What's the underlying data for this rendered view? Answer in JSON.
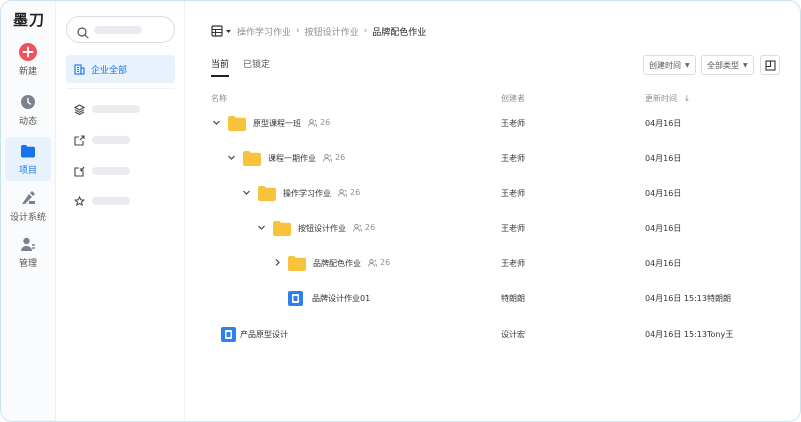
{
  "app": {
    "logo": "墨刀"
  },
  "rail": {
    "items": [
      {
        "label": "新建",
        "icon": "plus-circle-icon"
      },
      {
        "label": "动态",
        "icon": "clock-icon"
      },
      {
        "label": "项目",
        "icon": "folder-icon",
        "active": true
      },
      {
        "label": "设计系统",
        "icon": "design-system-icon"
      },
      {
        "label": "管理",
        "icon": "admin-user-icon"
      }
    ]
  },
  "sidebar": {
    "active_item": "企业全部"
  },
  "breadcrumb": {
    "items": [
      "操作学习作业",
      "按钮设计作业"
    ],
    "current": "品牌配色作业"
  },
  "tabs": [
    {
      "label": "当前",
      "active": true
    },
    {
      "label": "已锁定",
      "active": false
    }
  ],
  "filters": {
    "sort": "创建时间",
    "type": "全部类型"
  },
  "table": {
    "headers": {
      "name": "名称",
      "creator": "创建者",
      "updated": "更新时间"
    },
    "rows": [
      {
        "name": "原型课程一班",
        "members": "26",
        "creator": "王老师",
        "updated": "04月16日",
        "updater": "",
        "expanded": true,
        "kind": "folder"
      },
      {
        "name": "课程一期作业",
        "members": "26",
        "creator": "王老师",
        "updated": "04月16日",
        "updater": "",
        "expanded": true,
        "kind": "folder"
      },
      {
        "name": "操作学习作业",
        "members": "26",
        "creator": "王老师",
        "updated": "04月16日",
        "updater": "",
        "expanded": true,
        "kind": "folder"
      },
      {
        "name": "按钮设计作业",
        "members": "26",
        "creator": "王老师",
        "updated": "04月16日",
        "updater": "",
        "expanded": true,
        "kind": "folder"
      },
      {
        "name": "品牌配色作业",
        "members": "26",
        "creator": "王老师",
        "updated": "04月16日",
        "updater": "",
        "expanded": false,
        "kind": "folder"
      },
      {
        "name": "品牌设计作业01",
        "members": "",
        "creator": "特朗朗",
        "updated": "04月16日 15:13",
        "updater": "特朗朗",
        "kind": "file"
      },
      {
        "name": "产品原型设计",
        "members": "",
        "creator": "设计宏",
        "updated": "04月16日 15:13",
        "updater": "Tony王",
        "kind": "file"
      }
    ]
  },
  "colors": {
    "accent": "#1a73e8",
    "folder": "#f9c23c",
    "new_button": "#f0525a"
  }
}
